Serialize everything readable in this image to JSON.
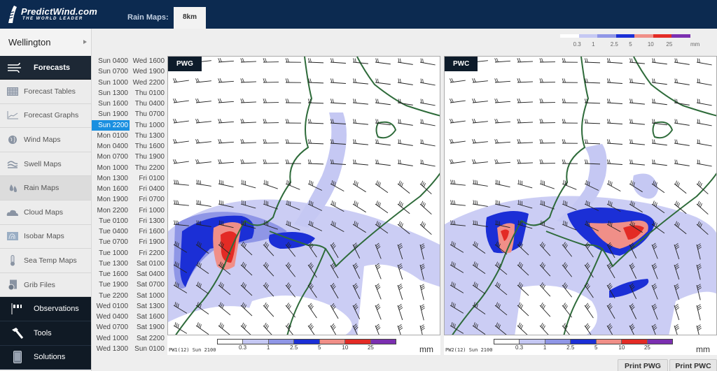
{
  "app": {
    "brand": "PredictWind.com",
    "tagline": "THE WORLD LEADER"
  },
  "header": {
    "maps_label": "Rain Maps:",
    "resolution_tab": "8km"
  },
  "sidebar": {
    "location": "Wellington",
    "main_section": {
      "label": "Forecasts",
      "icon": "wind-icon"
    },
    "sub_items": [
      {
        "label": "Forecast Tables",
        "icon": "table-icon",
        "active": false
      },
      {
        "label": "Forecast Graphs",
        "icon": "graph-icon",
        "active": false
      },
      {
        "label": "Wind Maps",
        "icon": "globe-icon",
        "active": false
      },
      {
        "label": "Swell Maps",
        "icon": "wave-icon",
        "active": false
      },
      {
        "label": "Rain Maps",
        "icon": "raindrop-icon",
        "active": true
      },
      {
        "label": "Cloud Maps",
        "icon": "cloud-icon",
        "active": false
      },
      {
        "label": "Isobar Maps",
        "icon": "isobar-icon",
        "active": false
      },
      {
        "label": "Sea Temp Maps",
        "icon": "thermometer-icon",
        "active": false
      },
      {
        "label": "Grib Files",
        "icon": "grib-file-icon",
        "active": false
      }
    ],
    "dark_items": [
      {
        "label": "Observations",
        "icon": "flags-icon"
      },
      {
        "label": "Tools",
        "icon": "hammer-icon"
      },
      {
        "label": "Solutions",
        "icon": "phone-icon"
      }
    ]
  },
  "timelist": {
    "selected": "Sun 2200",
    "col1": [
      "Sun 0400",
      "Sun 0700",
      "Sun 1000",
      "Sun 1300",
      "Sun 1600",
      "Sun 1900",
      "Sun 2200",
      "Mon 0100",
      "Mon 0400",
      "Mon 0700",
      "Mon 1000",
      "Mon 1300",
      "Mon 1600",
      "Mon 1900",
      "Mon 2200",
      "Tue 0100",
      "Tue 0400",
      "Tue 0700",
      "Tue 1000",
      "Tue 1300",
      "Tue 1600",
      "Tue 1900",
      "Tue 2200",
      "Wed 0100",
      "Wed 0400",
      "Wed 0700",
      "Wed 1000",
      "Wed 1300"
    ],
    "col2": [
      "Wed 1600",
      "Wed 1900",
      "Wed 2200",
      "Thu 0100",
      "Thu 0400",
      "Thu 0700",
      "Thu 1000",
      "Thu 1300",
      "Thu 1600",
      "Thu 1900",
      "Thu 2200",
      "Fri 0100",
      "Fri 0400",
      "Fri 0700",
      "Fri 1000",
      "Fri 1300",
      "Fri 1600",
      "Fri 1900",
      "Fri 2200",
      "Sat 0100",
      "Sat 0400",
      "Sat 0700",
      "Sat 1000",
      "Sat 1300",
      "Sat 1600",
      "Sat 1900",
      "Sat 2200",
      "Sun 0100"
    ]
  },
  "legend": {
    "colors": [
      "#ffffff",
      "#c5c8f3",
      "#8f96e6",
      "#1b2fd6",
      "#f08f88",
      "#e32b25",
      "#7b2fb0"
    ],
    "ticks": [
      "0.3",
      "1",
      "2.5",
      "5",
      "10",
      "25"
    ],
    "unit": "mm"
  },
  "maps": [
    {
      "tag": "PWG",
      "run_label": "PW1(12) Sun 2100",
      "print_label": "Print PWG"
    },
    {
      "tag": "PWC",
      "run_label": "PW2(12) Sun 2100",
      "print_label": "Print PWC"
    }
  ],
  "colors": {
    "topbar": "#0c2a50",
    "sidebar_dark": "#101a25",
    "selected_time": "#1a8fe0",
    "coastline": "#2e6b3a"
  }
}
